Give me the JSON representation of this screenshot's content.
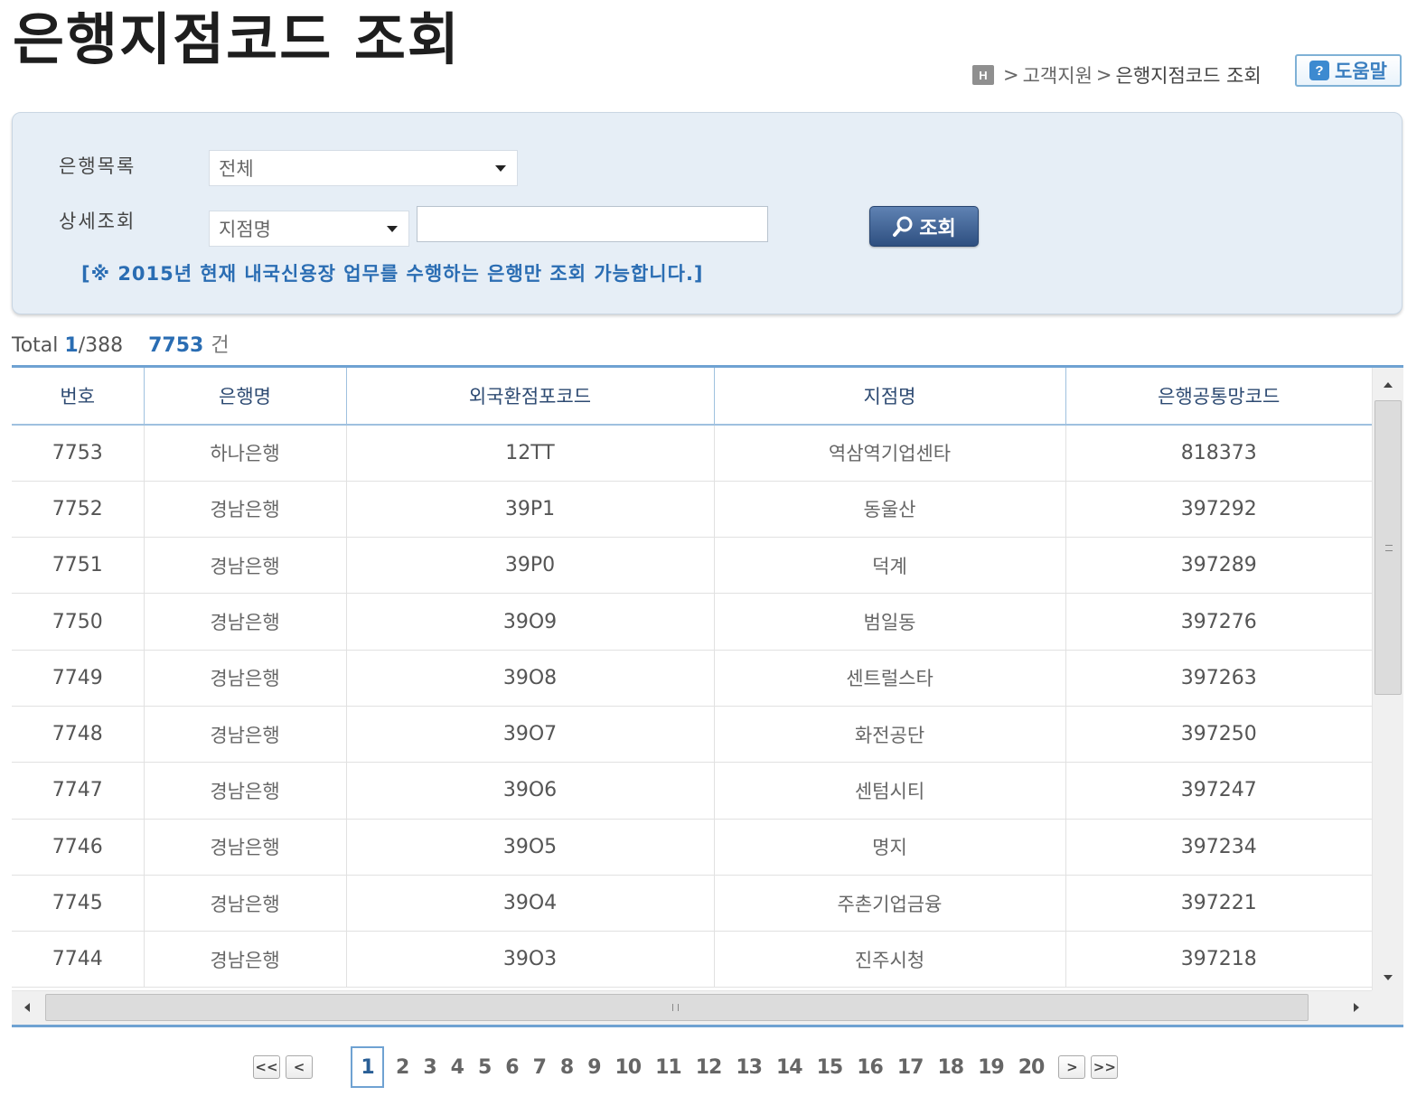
{
  "title": "은행지점코드 조회",
  "breadcrumb": {
    "home_icon": "H",
    "sep1": ">",
    "section": "고객지원",
    "sep2": ">",
    "current": "은행지점코드 조회"
  },
  "help": {
    "icon": "?",
    "label": "도움말"
  },
  "search": {
    "bank_list_label": "은행목록",
    "bank_select_value": "전체",
    "detail_label": "상세조회",
    "detail_select_value": "지점명",
    "detail_input_value": "",
    "search_button_label": "조회",
    "notice": "[※ 2015년 현재 내국신용장 업무를 수행하는 은행만 조회 가능합니다.]"
  },
  "summary": {
    "total_label": "Total",
    "current_page": "1",
    "page_sep": "/",
    "total_pages": "388",
    "record_count": "7753",
    "record_unit": "건"
  },
  "table": {
    "columns": [
      "번호",
      "은행명",
      "외국환점포코드",
      "지점명",
      "은행공통망코드"
    ],
    "rows": [
      [
        "7753",
        "하나은행",
        "12TT",
        "역삼역기업센타",
        "818373"
      ],
      [
        "7752",
        "경남은행",
        "39P1",
        "동울산",
        "397292"
      ],
      [
        "7751",
        "경남은행",
        "39P0",
        "덕계",
        "397289"
      ],
      [
        "7750",
        "경남은행",
        "39O9",
        "범일동",
        "397276"
      ],
      [
        "7749",
        "경남은행",
        "39O8",
        "센트럴스타",
        "397263"
      ],
      [
        "7748",
        "경남은행",
        "39O7",
        "화전공단",
        "397250"
      ],
      [
        "7747",
        "경남은행",
        "39O6",
        "센텀시티",
        "397247"
      ],
      [
        "7746",
        "경남은행",
        "39O5",
        "명지",
        "397234"
      ],
      [
        "7745",
        "경남은행",
        "39O4",
        "주촌기업금융",
        "397221"
      ],
      [
        "7744",
        "경남은행",
        "39O3",
        "진주시청",
        "397218"
      ]
    ]
  },
  "pagination": {
    "first": "<<",
    "prev": "<",
    "current": "1",
    "pages": [
      "2",
      "3",
      "4",
      "5",
      "6",
      "7",
      "8",
      "9",
      "10",
      "11",
      "12",
      "13",
      "14",
      "15",
      "16",
      "17",
      "18",
      "19",
      "20"
    ],
    "next": ">",
    "last": ">>"
  },
  "colors": {
    "accent_blue": "#2a6db3",
    "panel_bg": "#e6eef6",
    "grid_border": "#6fa2d2",
    "search_button": "#3a5d8f"
  },
  "icons": {
    "home": "home-icon",
    "help": "question-icon",
    "search": "magnifier-icon"
  }
}
